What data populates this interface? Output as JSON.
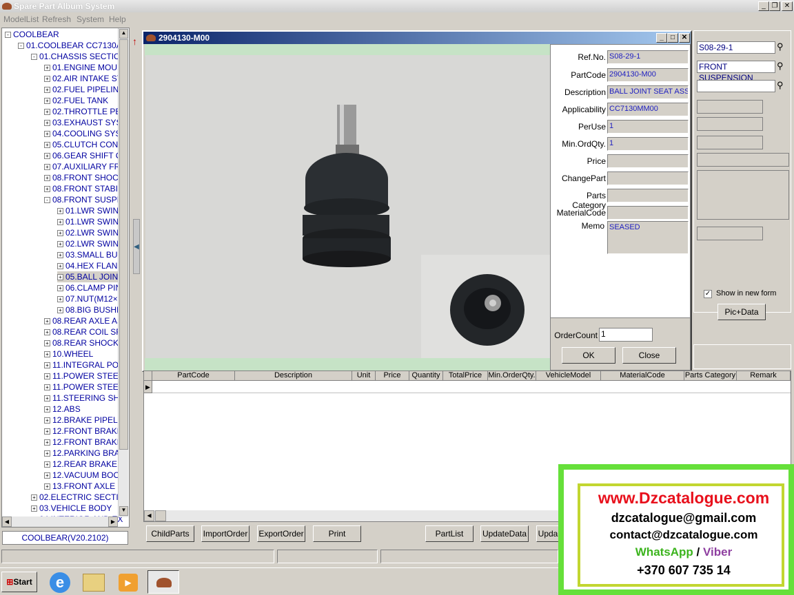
{
  "app": {
    "title": "Spare Part Album System"
  },
  "menu": [
    "ModelList",
    "Refresh",
    "System",
    "Help"
  ],
  "tree": [
    {
      "label": "COOLBEAR",
      "toggle": "-",
      "indent": 0
    },
    {
      "label": "01.COOLBEAR CC7130AN",
      "toggle": "-",
      "indent": 1
    },
    {
      "label": "01.CHASSIS SECTION",
      "toggle": "-",
      "indent": 2
    },
    {
      "label": "01.ENGINE MOUN",
      "toggle": "+",
      "indent": 3
    },
    {
      "label": "02.AIR INTAKE SY",
      "toggle": "+",
      "indent": 3
    },
    {
      "label": "02.FUEL PIPELINI",
      "toggle": "+",
      "indent": 3
    },
    {
      "label": "02.FUEL TANK",
      "toggle": "+",
      "indent": 3
    },
    {
      "label": "02.THROTTLE PE",
      "toggle": "+",
      "indent": 3
    },
    {
      "label": "03.EXHAUST SYS",
      "toggle": "+",
      "indent": 3
    },
    {
      "label": "04.COOLING SYS",
      "toggle": "+",
      "indent": 3
    },
    {
      "label": "05.CLUTCH CONT",
      "toggle": "+",
      "indent": 3
    },
    {
      "label": "06.GEAR SHIFT C",
      "toggle": "+",
      "indent": 3
    },
    {
      "label": "07.AUXILIARY FR",
      "toggle": "+",
      "indent": 3
    },
    {
      "label": "08.FRONT SHOCK",
      "toggle": "+",
      "indent": 3
    },
    {
      "label": "08.FRONT STABII",
      "toggle": "+",
      "indent": 3
    },
    {
      "label": "08.FRONT SUSPE",
      "toggle": "-",
      "indent": 3
    },
    {
      "label": "01.LWR SWIN",
      "toggle": "+",
      "indent": 4
    },
    {
      "label": "01.LWR SWIN",
      "toggle": "+",
      "indent": 4
    },
    {
      "label": "02.LWR SWIN",
      "toggle": "+",
      "indent": 4
    },
    {
      "label": "02.LWR SWIN",
      "toggle": "+",
      "indent": 4
    },
    {
      "label": "03.SMALL BU",
      "toggle": "+",
      "indent": 4
    },
    {
      "label": "04.HEX FLANG",
      "toggle": "+",
      "indent": 4
    },
    {
      "label": "05.BALL JOIN",
      "toggle": "+",
      "indent": 4,
      "selected": true
    },
    {
      "label": "06.CLAMP PIN",
      "toggle": "+",
      "indent": 4
    },
    {
      "label": "07.NUT(M12×",
      "toggle": "+",
      "indent": 4
    },
    {
      "label": "08.BIG BUSHI",
      "toggle": "+",
      "indent": 4
    },
    {
      "label": "08.REAR AXLE AS",
      "toggle": "+",
      "indent": 3
    },
    {
      "label": "08.REAR COIL SF",
      "toggle": "+",
      "indent": 3
    },
    {
      "label": "08.REAR SHOCK",
      "toggle": "+",
      "indent": 3
    },
    {
      "label": "10.WHEEL",
      "toggle": "+",
      "indent": 3
    },
    {
      "label": "11.INTEGRAL PO",
      "toggle": "+",
      "indent": 3
    },
    {
      "label": "11.POWER STEE",
      "toggle": "+",
      "indent": 3
    },
    {
      "label": "11.POWER STEE",
      "toggle": "+",
      "indent": 3
    },
    {
      "label": "11.STEERING SH",
      "toggle": "+",
      "indent": 3
    },
    {
      "label": "12.ABS",
      "toggle": "+",
      "indent": 3
    },
    {
      "label": "12.BRAKE PIPELI",
      "toggle": "+",
      "indent": 3
    },
    {
      "label": "12.FRONT BRAKE",
      "toggle": "+",
      "indent": 3
    },
    {
      "label": "12.FRONT BRAKE",
      "toggle": "+",
      "indent": 3
    },
    {
      "label": "12.PARKING BRA",
      "toggle": "+",
      "indent": 3
    },
    {
      "label": "12.REAR BRAKE",
      "toggle": "+",
      "indent": 3
    },
    {
      "label": "12.VACUUM BOO",
      "toggle": "+",
      "indent": 3
    },
    {
      "label": "13.FRONT AXLE I",
      "toggle": "+",
      "indent": 3
    },
    {
      "label": "02.ELECTRIC SECTIC",
      "toggle": "+",
      "indent": 2
    },
    {
      "label": "03.VEHICLE BODY",
      "toggle": "+",
      "indent": 2
    },
    {
      "label": "04.INTERIOR AND EX",
      "toggle": "+",
      "indent": 2
    }
  ],
  "model_version": "COOLBEAR(V20.2102)",
  "right_panel": {
    "search1": "S08-29-1",
    "search2": "FRONT SUSPENSION",
    "search3": "",
    "show_in_new_form_label": "Show in new form",
    "show_in_new_form_checked": true,
    "pic_data_button": "Pic+Data"
  },
  "dialog": {
    "title": "2904130-M00",
    "fields": [
      {
        "label": "Ref.No.",
        "value": "S08-29-1"
      },
      {
        "label": "PartCode",
        "value": "2904130-M00"
      },
      {
        "label": "Description",
        "value": "BALL JOINT SEAT ASS"
      },
      {
        "label": "Applicability",
        "value": "CC7130MM00"
      },
      {
        "label": "PerUse",
        "value": "1"
      },
      {
        "label": "Min.OrdQty.",
        "value": "1"
      },
      {
        "label": "Price",
        "value": ""
      },
      {
        "label": "ChangePart",
        "value": ""
      },
      {
        "label": "Parts Category",
        "value": ""
      },
      {
        "label": "MaterialCode",
        "value": ""
      }
    ],
    "memo_label": "Memo",
    "memo_value": "SEASED",
    "order_count_label": "OrderCount",
    "order_count_value": "1",
    "ok_button": "OK",
    "close_button": "Close"
  },
  "grid": {
    "columns": [
      "PartCode",
      "Description",
      "Unit",
      "Price",
      "Quantity",
      "TotalPrice",
      "Min.OrderQty.",
      "VehicleModel",
      "MaterialCode",
      "Parts Category",
      "Remark"
    ]
  },
  "bottom_buttons": [
    "ChildParts",
    "ImportOrder",
    "ExportOrder",
    "Print",
    "PartList",
    "UpdateData",
    "Upda"
  ],
  "taskbar": {
    "start": "Start"
  },
  "ad": {
    "site": "www.Dzcatalogue.com",
    "email1": "dzcatalogue@gmail.com",
    "email2": "contact@dzcatalogue.com",
    "whatsapp": "WhatsApp",
    "slash": "/",
    "viber": "Viber",
    "phone": "+370 607 735 14",
    "colors": {
      "site": "#e8101c",
      "whatsapp": "#3cb41e",
      "viber": "#8e3fa0",
      "frame": "#66e03a"
    }
  }
}
